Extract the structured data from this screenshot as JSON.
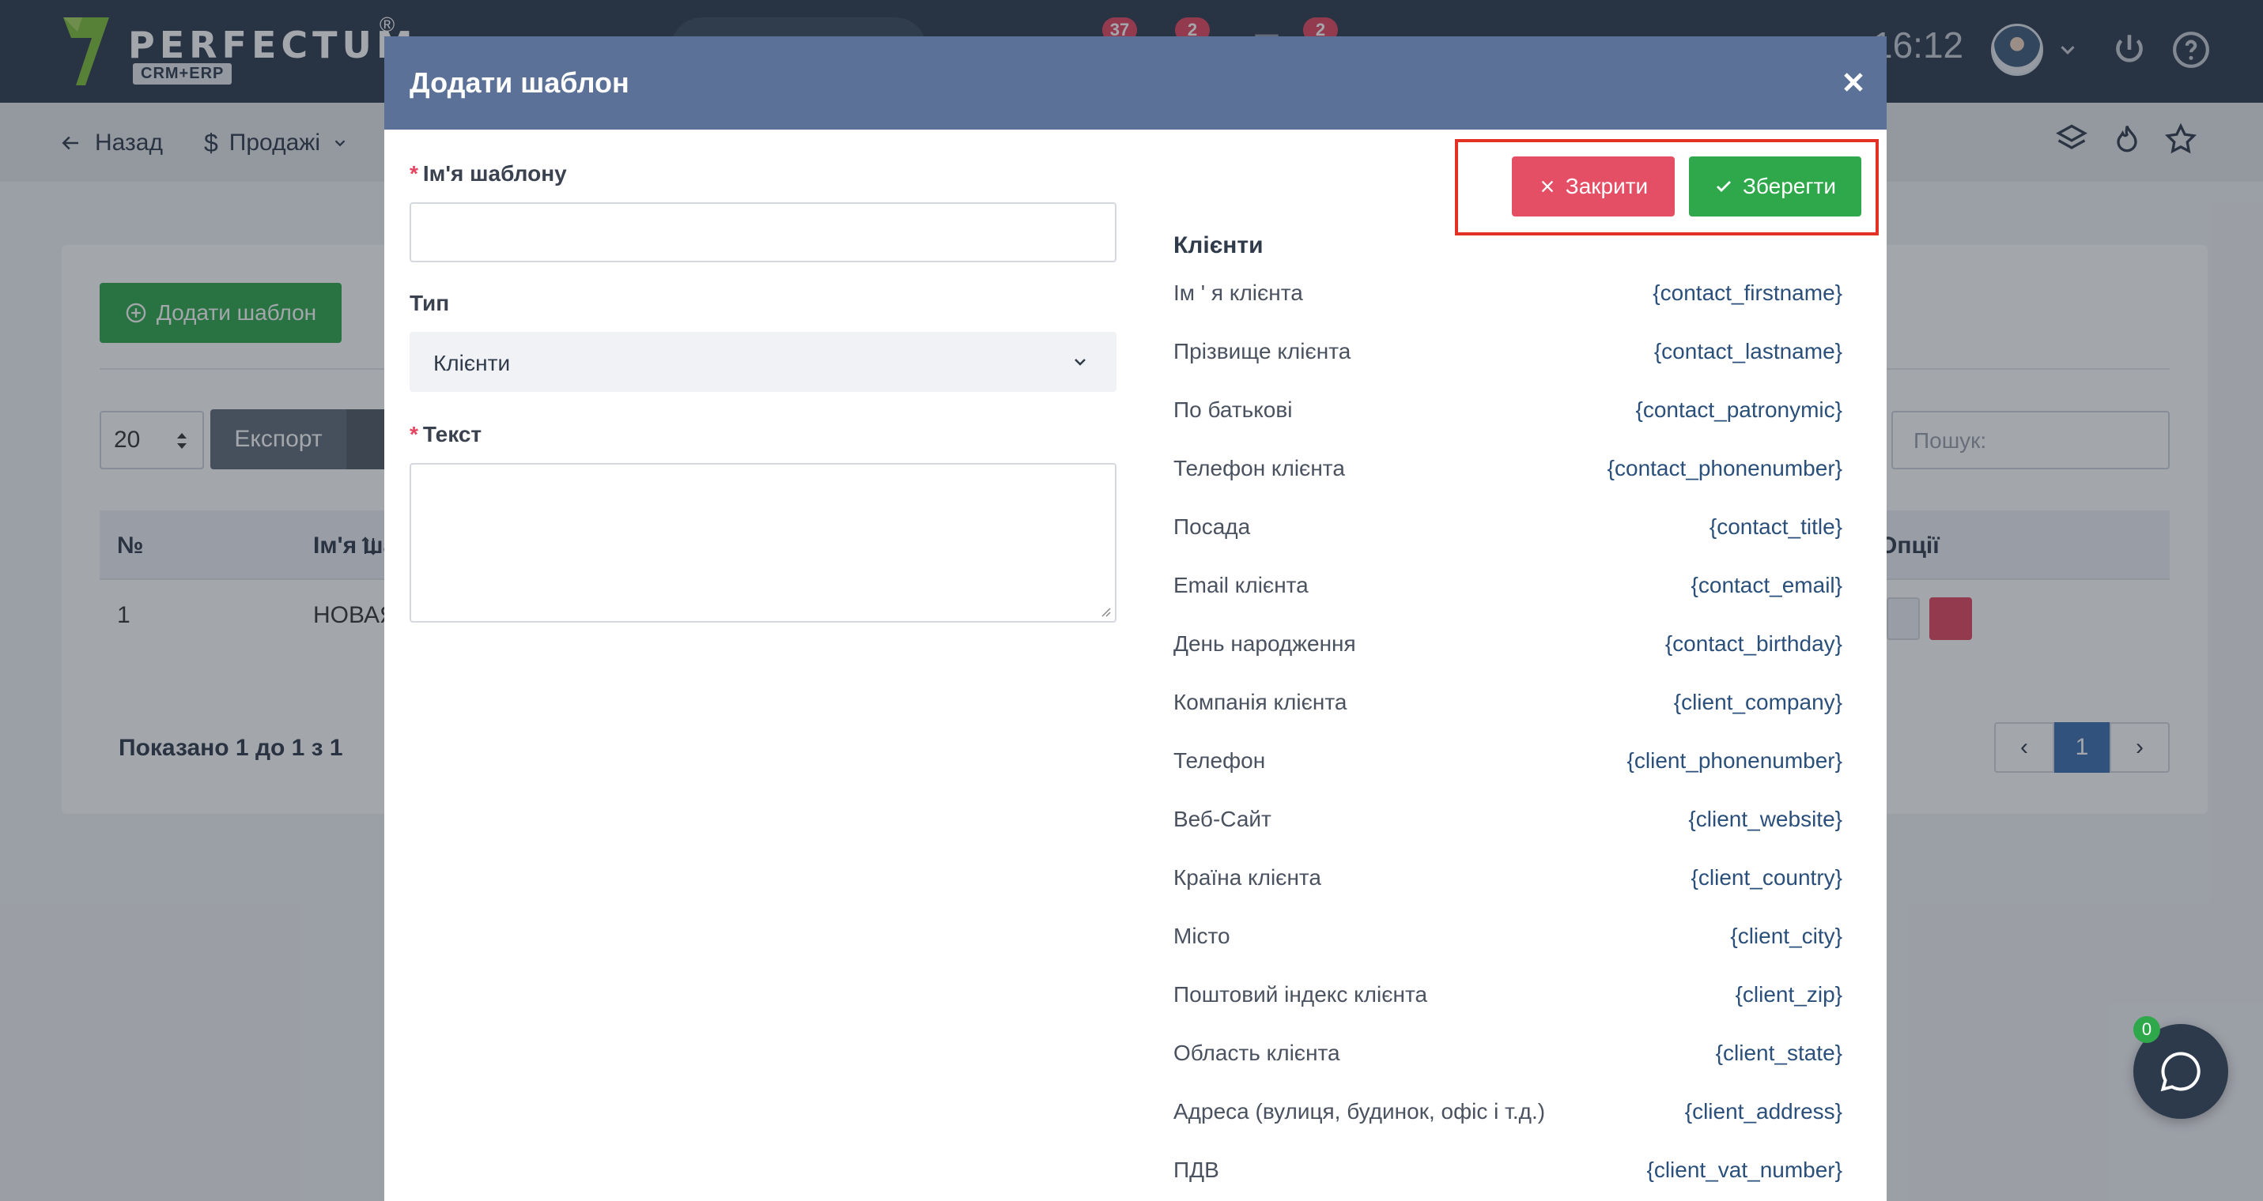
{
  "header": {
    "logo_text": "PERFECTUM",
    "logo_reg": "®",
    "logo_sub": "CRM+ERP",
    "badges": [
      "37",
      "2",
      "2"
    ],
    "clock": "16:12"
  },
  "toolbar": {
    "back_label": "Назад",
    "sales_label": "Продажі"
  },
  "page": {
    "add_template_label": "Додати шаблон",
    "page_size": "20",
    "export_label": "Експорт",
    "search_placeholder": "Пошук:",
    "columns": {
      "number": "№",
      "name": "Ім'я ша",
      "options": "Опції"
    },
    "rows": [
      {
        "number": "1",
        "name": "НОВАЯ"
      }
    ],
    "showing_text": "Показано 1 до 1 з 1",
    "pagination": {
      "current": "1"
    }
  },
  "modal": {
    "title": "Додати шаблон",
    "fields": {
      "name_label": "Ім'я шаблону",
      "name_value": "",
      "type_label": "Тип",
      "type_value": "Клієнти",
      "text_label": "Текст",
      "text_value": ""
    },
    "close_button": "Закрити",
    "save_button": "Зберегти",
    "variables_heading": "Клієнти",
    "variables": [
      {
        "label": "Ім ' я клієнта",
        "code": "{contact_firstname}"
      },
      {
        "label": "Прізвище клієнта",
        "code": "{contact_lastname}"
      },
      {
        "label": "По батькові",
        "code": "{contact_patronymic}"
      },
      {
        "label": "Телефон клієнта",
        "code": "{contact_phonenumber}"
      },
      {
        "label": "Посада",
        "code": "{contact_title}"
      },
      {
        "label": "Email клієнта",
        "code": "{contact_email}"
      },
      {
        "label": "День народження",
        "code": "{contact_birthday}"
      },
      {
        "label": "Компанія клієнта",
        "code": "{client_company}"
      },
      {
        "label": "Телефон",
        "code": "{client_phonenumber}"
      },
      {
        "label": "Веб-Сайт",
        "code": "{client_website}"
      },
      {
        "label": "Країна клієнта",
        "code": "{client_country}"
      },
      {
        "label": "Місто",
        "code": "{client_city}"
      },
      {
        "label": "Поштовий індекс клієнта",
        "code": "{client_zip}"
      },
      {
        "label": "Область клієнта",
        "code": "{client_state}"
      },
      {
        "label": "Адреса (вулиця, будинок, офіс і т.д.)",
        "code": "{client_address}"
      },
      {
        "label": "ПДВ",
        "code": "{client_vat_number}"
      }
    ]
  },
  "chat": {
    "unread": "0"
  },
  "colors": {
    "header_bg": "#2c3a4c",
    "modal_header": "#5b7198",
    "success": "#2ea84a",
    "danger": "#e54f66",
    "highlight": "#e33125",
    "link": "#2a4f7a"
  }
}
